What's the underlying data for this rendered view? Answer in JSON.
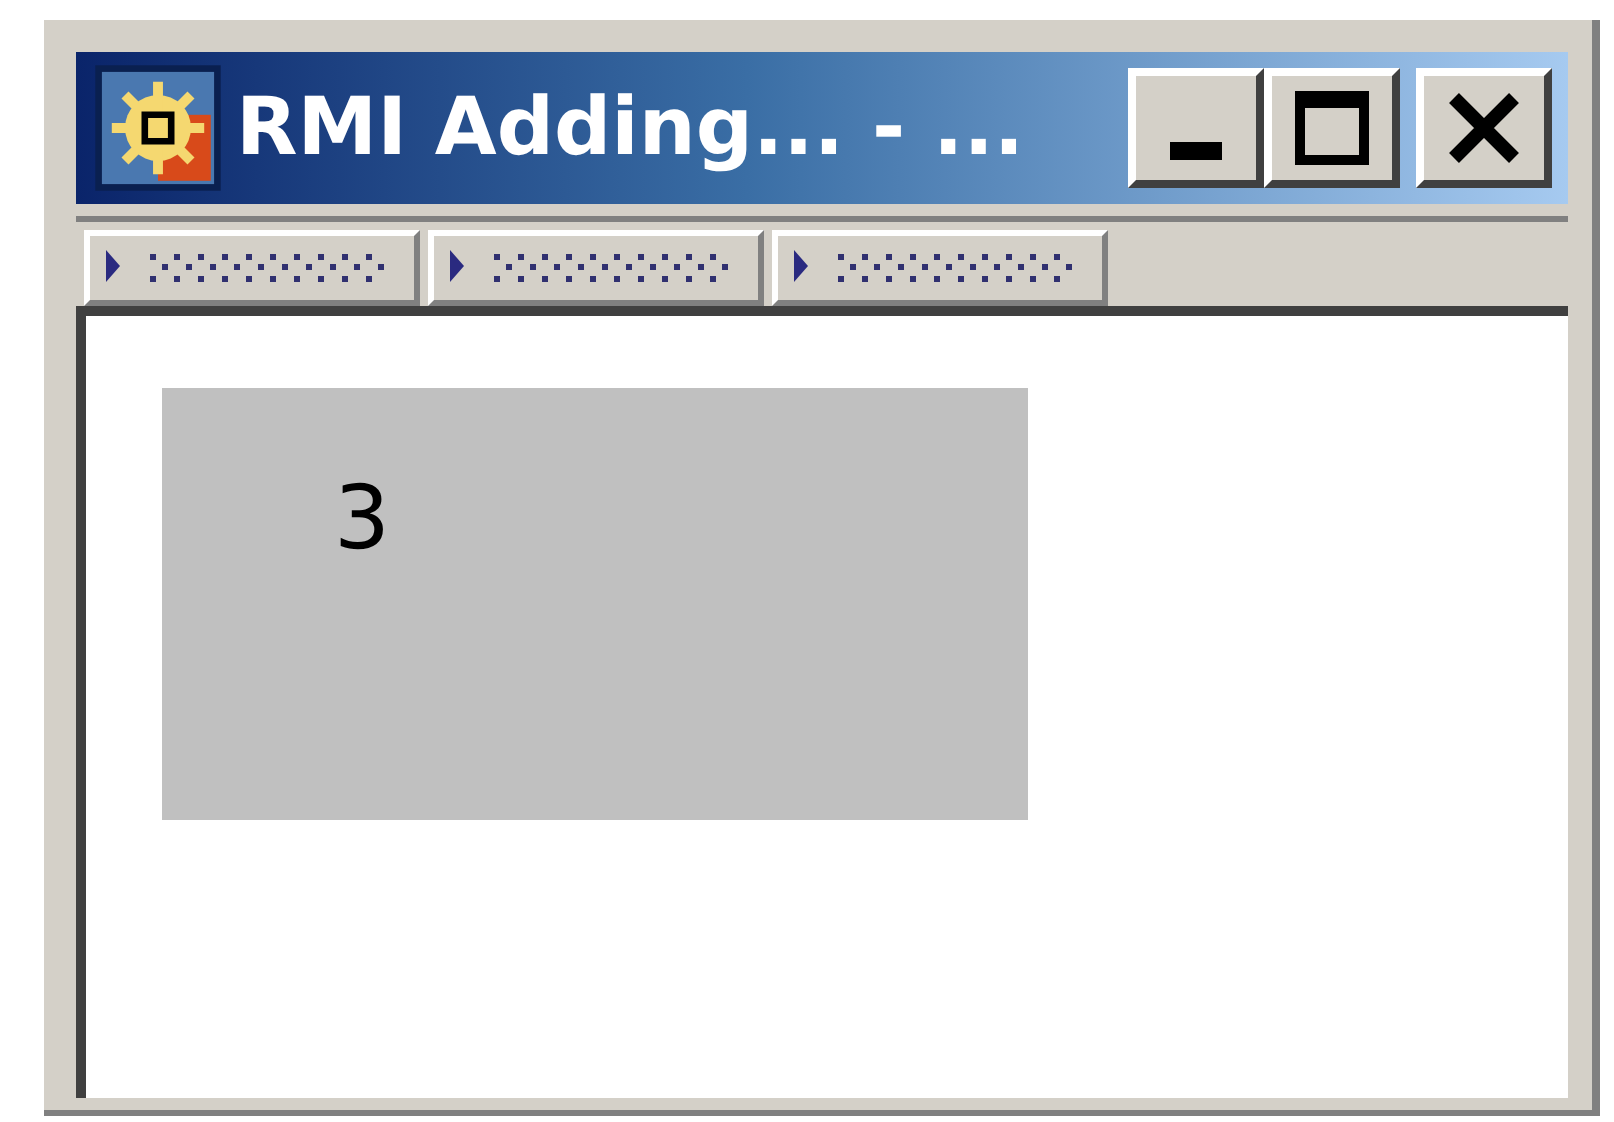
{
  "window": {
    "title": "RMI Adding... - ..."
  },
  "result_panel": {
    "value": "3"
  }
}
